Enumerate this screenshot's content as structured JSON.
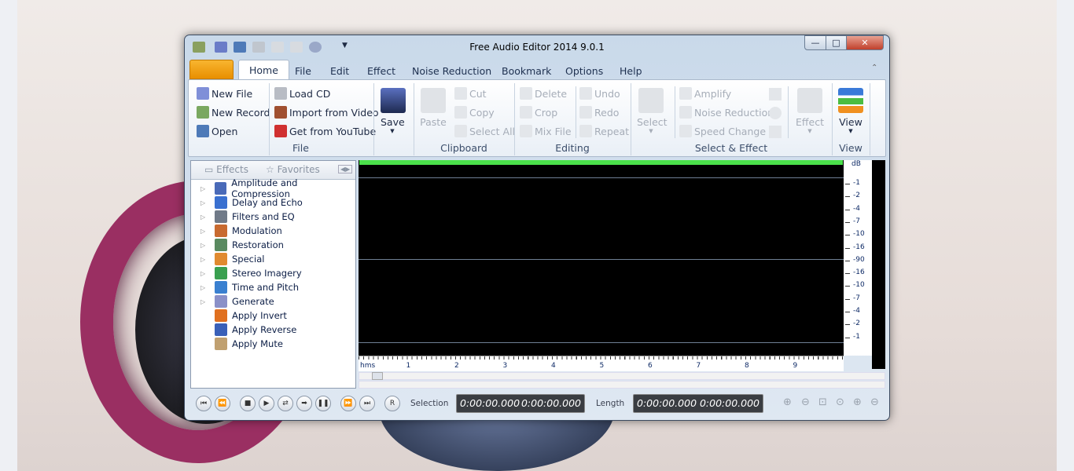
{
  "window": {
    "title": "Free Audio Editor 2014 9.0.1",
    "minimize": "—",
    "maximize": "□",
    "close": "✕"
  },
  "tabs": [
    "Home",
    "File",
    "Edit",
    "Effect",
    "Noise Reduction",
    "Bookmark",
    "Options",
    "Help"
  ],
  "ribbon": {
    "file": {
      "label": "File",
      "new_file": "New File",
      "new_record": "New Record",
      "open": "Open",
      "load_cd": "Load CD",
      "import_video": "Import from Video",
      "youtube": "Get from YouTube",
      "save": "Save"
    },
    "clipboard": {
      "label": "Clipboard",
      "paste": "Paste",
      "cut": "Cut",
      "copy": "Copy",
      "select_all": "Select All"
    },
    "editing": {
      "label": "Editing",
      "delete": "Delete",
      "crop": "Crop",
      "mix_file": "Mix File",
      "undo": "Undo",
      "redo": "Redo",
      "repeat": "Repeat"
    },
    "select_effect": {
      "label": "Select & Effect",
      "select": "Select",
      "amplify": "Amplify",
      "noise_reduction": "Noise Reduction",
      "speed_change": "Speed Change",
      "effect": "Effect"
    },
    "view": {
      "label": "View",
      "view": "View"
    }
  },
  "left_panel": {
    "tab_effects": "Effects",
    "tab_favorites": "Favorites",
    "items": [
      "Amplitude and Compression",
      "Delay and Echo",
      "Filters and EQ",
      "Modulation",
      "Restoration",
      "Special",
      "Stereo Imagery",
      "Time and Pitch",
      "Generate",
      "Apply Invert",
      "Apply Reverse",
      "Apply Mute"
    ]
  },
  "db_scale": [
    "dB",
    "-1",
    "-2",
    "-4",
    "-7",
    "-10",
    "-16",
    "-90",
    "-16",
    "-10",
    "-7",
    "-4",
    "-2",
    "-1"
  ],
  "time_ruler": [
    "hms",
    "1",
    "2",
    "3",
    "4",
    "5",
    "6",
    "7",
    "8",
    "9"
  ],
  "transport": {
    "record": "R",
    "selection_label": "Selection",
    "selection_start": "0:00:00.000",
    "selection_end": "0:00:00.000",
    "length_label": "Length",
    "length_start": "0:00:00.000",
    "length_end": "0:00:00.000"
  },
  "colors": {
    "level_meter": "#4be04b",
    "app_button": "#f0a010"
  }
}
